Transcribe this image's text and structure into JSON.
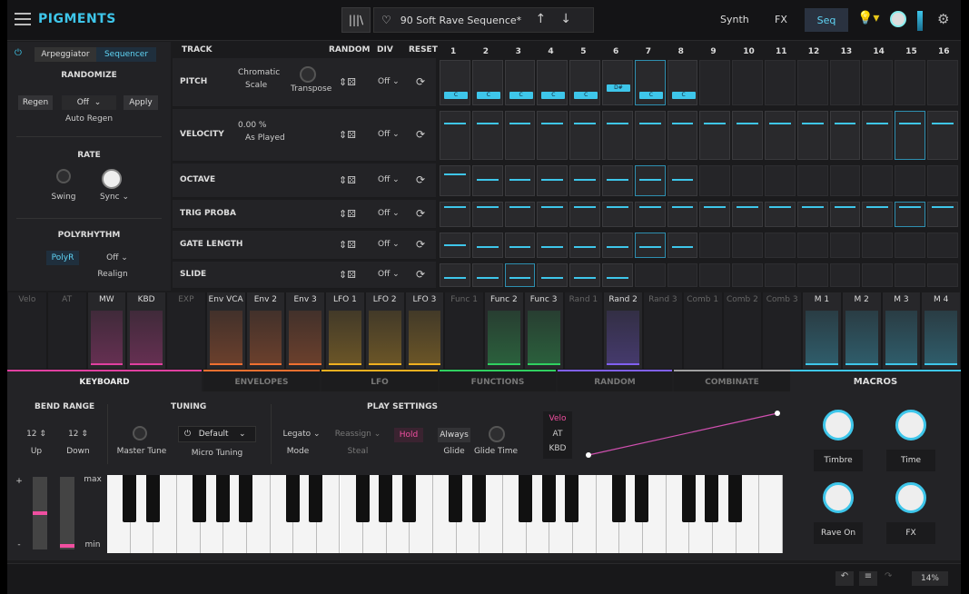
{
  "app": {
    "logo": "PIGMENTS",
    "preset_name": "90 Soft Rave Sequence*",
    "tabs": [
      "Synth",
      "FX",
      "Seq"
    ]
  },
  "left": {
    "mode_tabs": [
      "Arpeggiator",
      "Sequencer"
    ],
    "randomize": {
      "title": "RANDOMIZE",
      "regen": "Regen",
      "mode": "Off",
      "apply": "Apply",
      "auto": "Auto Regen"
    },
    "rate": {
      "title": "RATE",
      "swing": "Swing",
      "sync": "Sync"
    },
    "polyrhythm": {
      "title": "POLYRHYTHM",
      "polyr": "PolyR",
      "value": "Off",
      "realign": "Realign"
    }
  },
  "seq": {
    "headers": {
      "track": "TRACK",
      "random": "RANDOM",
      "div": "DIV",
      "reset": "RESET"
    },
    "steps": [
      "1",
      "2",
      "3",
      "4",
      "5",
      "6",
      "7",
      "8",
      "9",
      "10",
      "11",
      "12",
      "13",
      "14",
      "15",
      "16"
    ],
    "rows": [
      {
        "name": "PITCH",
        "c1": "Chromatic",
        "c2": "Scale",
        "c3": "Transpose",
        "div": "Off"
      },
      {
        "name": "VELOCITY",
        "c1": "0.00 %",
        "c2": "As Played",
        "c3": "",
        "div": "Off"
      },
      {
        "name": "OCTAVE",
        "c1": "",
        "c2": "",
        "c3": "",
        "div": "Off"
      },
      {
        "name": "TRIG PROBA",
        "c1": "",
        "c2": "",
        "c3": "",
        "div": "Off"
      },
      {
        "name": "GATE LENGTH",
        "c1": "",
        "c2": "",
        "c3": "",
        "div": "Off"
      },
      {
        "name": "SLIDE",
        "c1": "",
        "c2": "",
        "c3": "",
        "div": "Off"
      }
    ],
    "pitch_tags": [
      "C",
      "C",
      "C",
      "C",
      "C",
      "D#",
      "C",
      "C"
    ]
  },
  "mods": [
    "Velo",
    "AT",
    "MW",
    "KBD",
    "EXP",
    "Env VCA",
    "Env 2",
    "Env 3",
    "LFO 1",
    "LFO 2",
    "LFO 3",
    "Func 1",
    "Func 2",
    "Func 3",
    "Rand 1",
    "Rand 2",
    "Rand 3",
    "Comb 1",
    "Comb 2",
    "Comb 3",
    "M 1",
    "M 2",
    "M 3",
    "M 4"
  ],
  "bottom_tabs": [
    "KEYBOARD",
    "ENVELOPES",
    "LFO",
    "FUNCTIONS",
    "RANDOM",
    "COMBINATE"
  ],
  "keyboard": {
    "bend": {
      "title": "BEND RANGE",
      "up_val": "12",
      "down_val": "12",
      "up": "Up",
      "down": "Down"
    },
    "tuning": {
      "title": "TUNING",
      "master": "Master Tune",
      "default": "Default",
      "micro": "Micro Tuning"
    },
    "play": {
      "title": "PLAY SETTINGS",
      "legato": "Legato",
      "mode": "Mode",
      "reassign": "Reassign",
      "steal": "Steal",
      "hold": "Hold",
      "always": "Always",
      "glide": "Glide",
      "glide_time": "Glide Time"
    },
    "curve_src": [
      "Velo",
      "AT",
      "KBD"
    ],
    "slider": {
      "plus": "+",
      "max": "max",
      "min": "min",
      "minus": "-"
    }
  },
  "macros": {
    "title": "MACROS",
    "labels": [
      "Timbre",
      "Time",
      "Rave On",
      "FX"
    ]
  },
  "status": {
    "zoom": "14%"
  }
}
